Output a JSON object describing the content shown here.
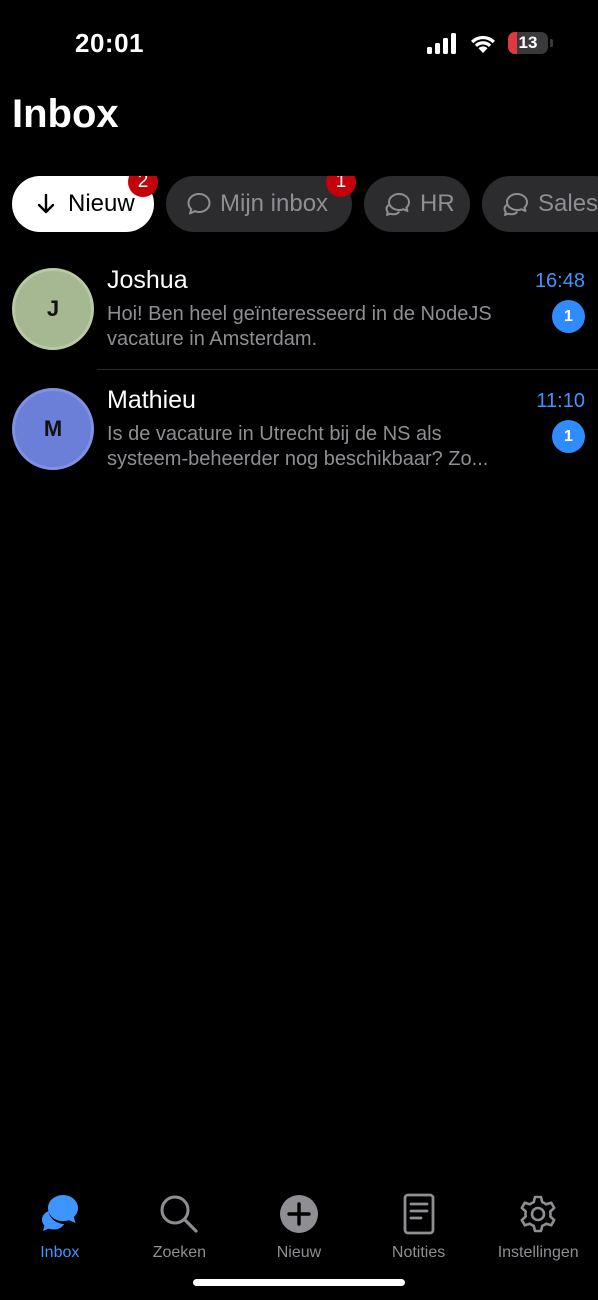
{
  "status_bar": {
    "time": "20:01",
    "battery_level": "13"
  },
  "page": {
    "title": "Inbox"
  },
  "filters": [
    {
      "label": "Nieuw",
      "icon": "arrow-down-icon",
      "badge": "2",
      "active": true
    },
    {
      "label": "Mijn inbox",
      "icon": "chat-bubble-icon",
      "badge": "1",
      "active": false
    },
    {
      "label": "HR",
      "icon": "chat-bubbles-icon",
      "badge": "",
      "active": false
    },
    {
      "label": "Sales",
      "icon": "chat-bubbles-icon",
      "badge": "",
      "active": false
    }
  ],
  "conversations": [
    {
      "initial": "J",
      "name": "Joshua",
      "time": "16:48",
      "preview_line1": "Hoi! Ben heel geïnteresseerd in de NodeJS",
      "preview_line2": "vacature in Amsterdam.",
      "unread": "1",
      "avatar_color": "#a5b891"
    },
    {
      "initial": "M",
      "name": "Mathieu",
      "time": "11:10",
      "preview_line1": "Is de vacature in Utrecht bij de NS als",
      "preview_line2": "systeem-beheerder nog beschikbaar? Zo...",
      "unread": "1",
      "avatar_color": "#6c7fd8"
    }
  ],
  "tab_bar": [
    {
      "label": "Inbox",
      "icon": "inbox-chat-icon",
      "active": true
    },
    {
      "label": "Zoeken",
      "icon": "search-icon",
      "active": false
    },
    {
      "label": "Nieuw",
      "icon": "plus-circle-icon",
      "active": false
    },
    {
      "label": "Notities",
      "icon": "notes-icon",
      "active": false
    },
    {
      "label": "Instellingen",
      "icon": "gear-icon",
      "active": false
    }
  ],
  "colors": {
    "accent": "#3e95ff",
    "badge_red": "#c4000b",
    "unread_blue": "#2f8cff",
    "background": "#000000"
  }
}
